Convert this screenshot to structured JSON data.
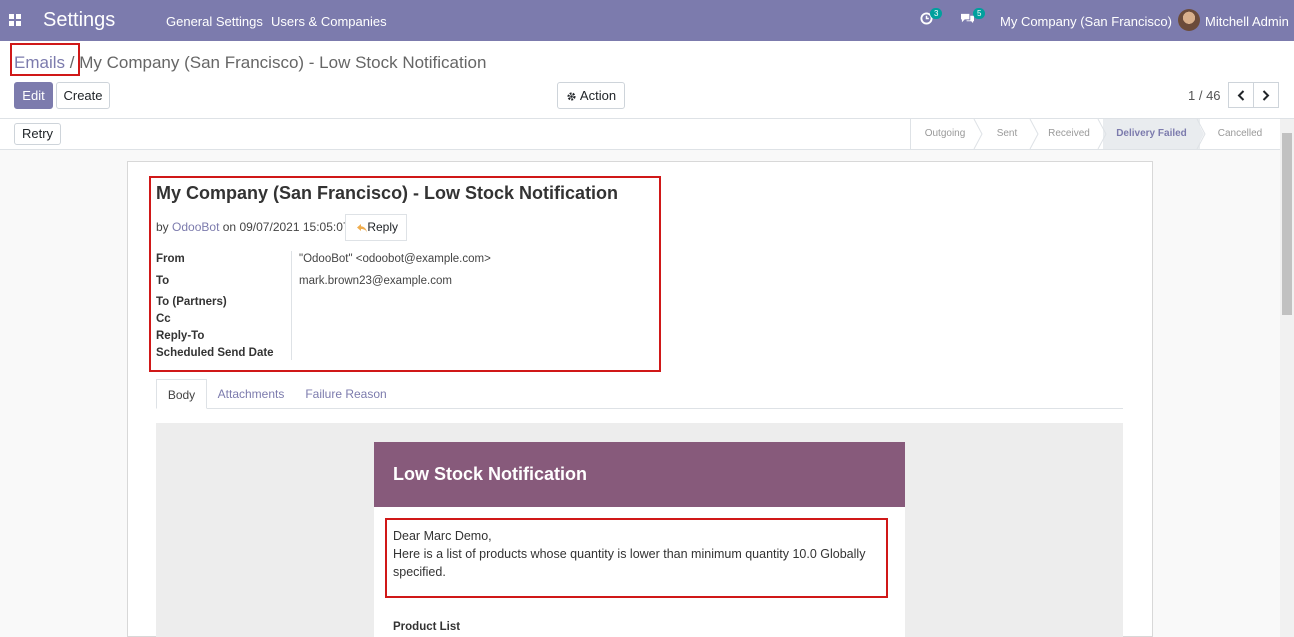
{
  "navbar": {
    "app_title": "Settings",
    "menu": [
      "General Settings",
      "Users & Companies"
    ],
    "activity_count": "3",
    "messages_count": "5",
    "company": "My Company (San Francisco)",
    "user": "Mitchell Admin",
    "bg_color": "#7c7bad"
  },
  "breadcrumb": {
    "parent": "Emails",
    "separator": "/",
    "current": "My Company (San Francisco) - Low Stock Notification"
  },
  "toolbar": {
    "edit_label": "Edit",
    "create_label": "Create",
    "action_label": "Action",
    "pager": "1 / 46"
  },
  "statusbar": {
    "retry_label": "Retry",
    "stages": [
      "Outgoing",
      "Sent",
      "Received",
      "Delivery Failed",
      "Cancelled"
    ],
    "active_stage": "Delivery Failed"
  },
  "mail": {
    "subject": "My Company (San Francisco) - Low Stock Notification",
    "by_prefix": "by",
    "author": "OdooBot",
    "on_prefix": "on",
    "date": "09/07/2021 15:05:07",
    "reply_label": "Reply",
    "fields": [
      {
        "label": "From",
        "value": "\"OdooBot\" <odoobot@example.com>"
      },
      {
        "label": "To",
        "value": "mark.brown23@example.com"
      },
      {
        "label": "To (Partners)",
        "value": ""
      },
      {
        "label": "Cc",
        "value": ""
      },
      {
        "label": "Reply-To",
        "value": ""
      },
      {
        "label": "Scheduled Send Date",
        "value": ""
      }
    ]
  },
  "tabs": [
    "Body",
    "Attachments",
    "Failure Reason"
  ],
  "body": {
    "header_title": "Low Stock Notification",
    "header_right": "",
    "greeting": "Dear Marc Demo,",
    "message": "Here is a list of products whose quantity is lower than minimum quantity 10.0 Globally specified.",
    "section_title": "Product List",
    "header_color": "#875a7b"
  }
}
